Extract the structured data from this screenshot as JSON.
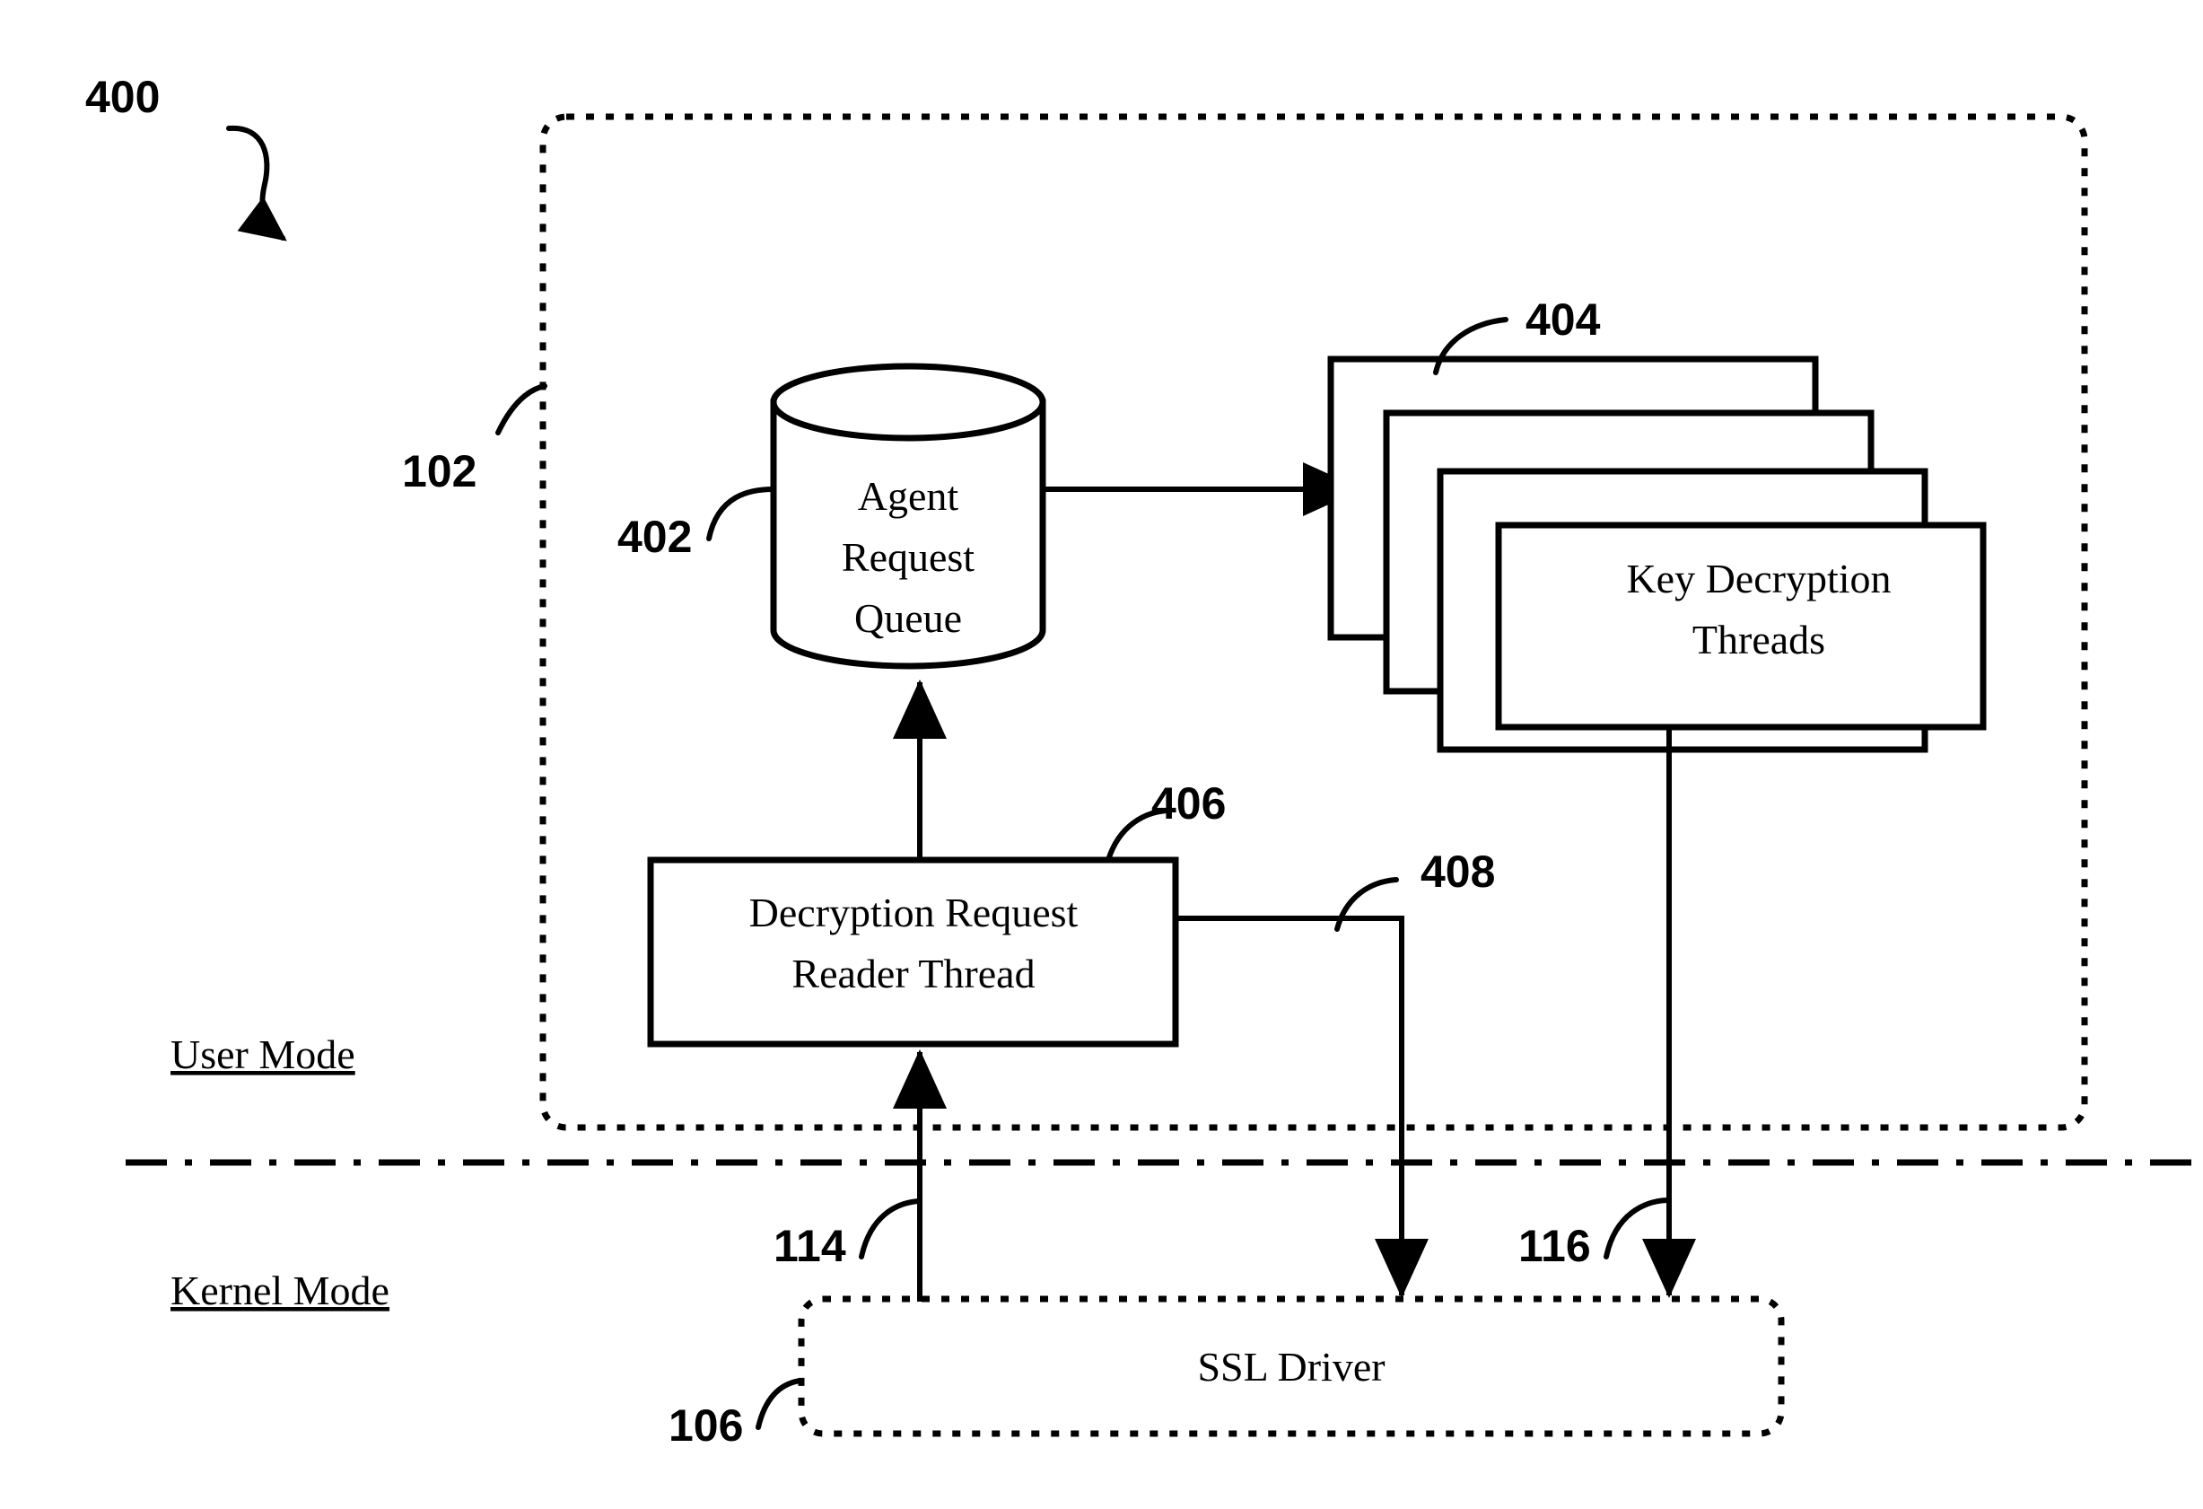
{
  "figure": {
    "number": "400",
    "region_label": "102",
    "mode_user": "User Mode",
    "mode_kernel": "Kernel Mode"
  },
  "nodes": {
    "queue": {
      "ref": "402",
      "line1": "Agent",
      "line2": "Request",
      "line3": "Queue"
    },
    "threads": {
      "ref": "404",
      "line1": "Key Decryption",
      "line2": "Threads",
      "stack_count": 4
    },
    "reader": {
      "ref": "406",
      "line1": "Decryption Request",
      "line2": "Reader Thread"
    },
    "ssl_driver": {
      "ref": "106",
      "label": "SSL Driver"
    }
  },
  "connectors": {
    "reader_to_driver": "408",
    "driver_to_reader": "114",
    "threads_to_driver": "116"
  }
}
